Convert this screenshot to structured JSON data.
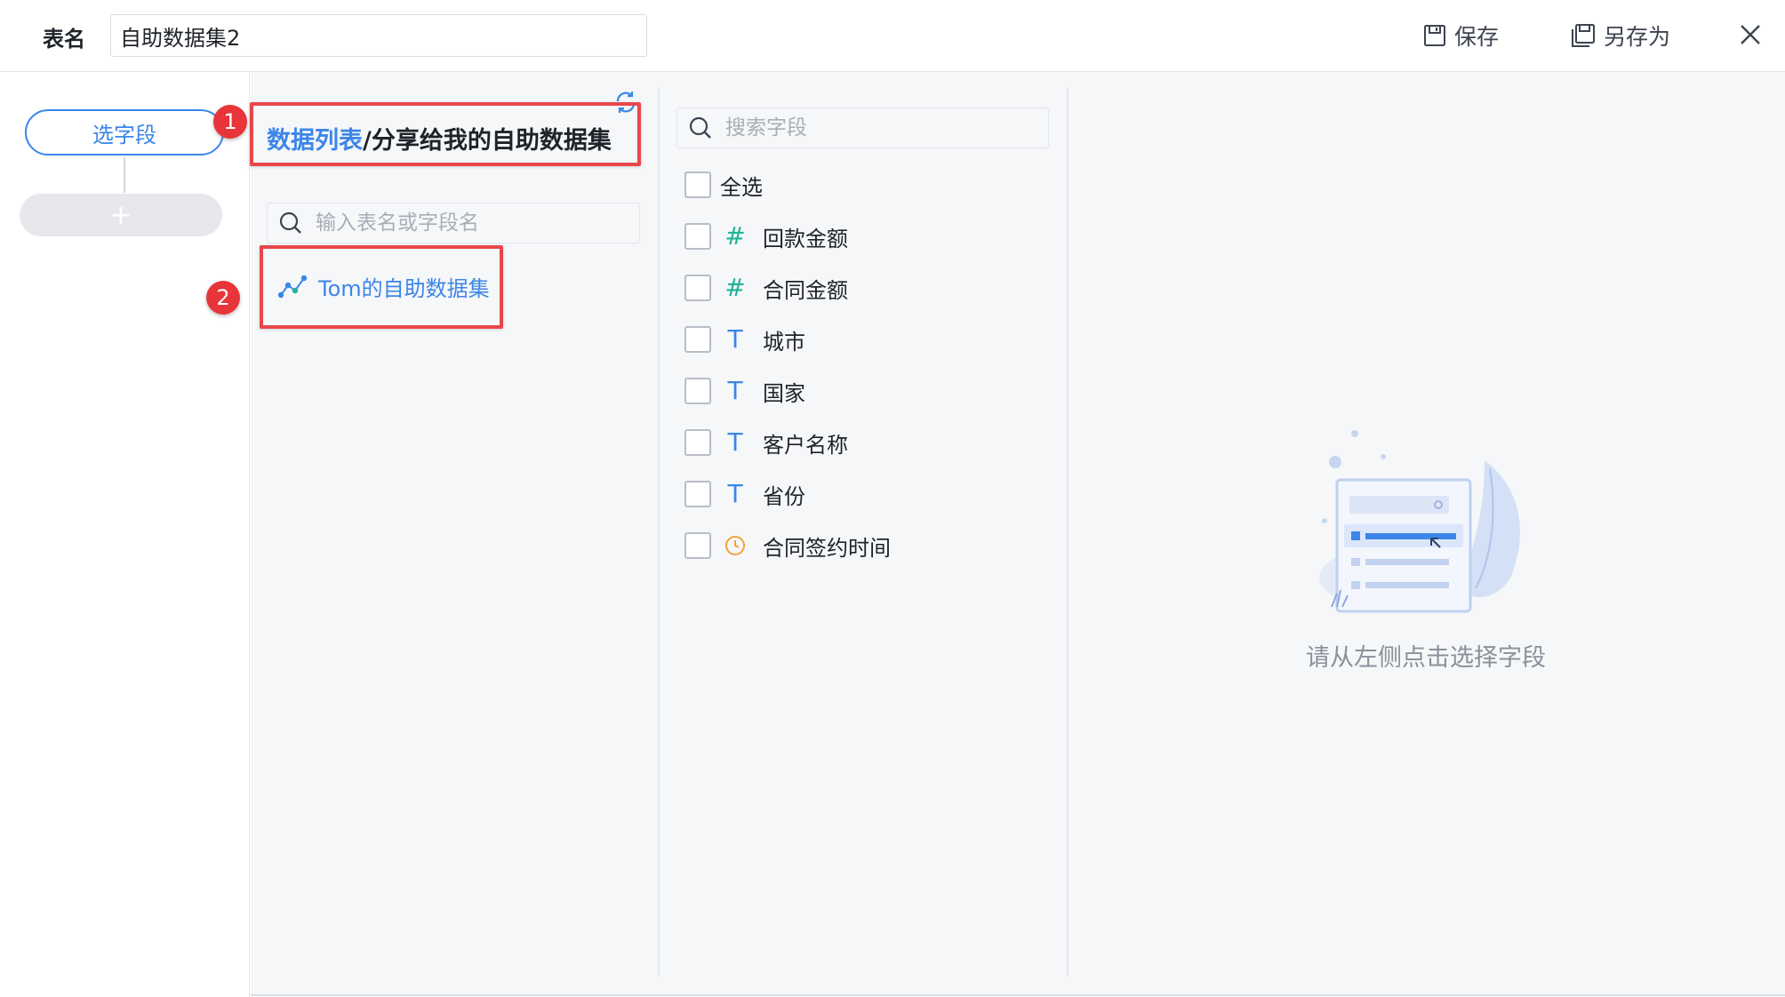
{
  "header": {
    "table_name_label": "表名",
    "table_name_value": "自助数据集2",
    "save_label": "保存",
    "save_as_label": "另存为"
  },
  "steps": {
    "current_step_label": "选字段",
    "add_step_label": "+"
  },
  "data_panel": {
    "breadcrumb_root": "数据列表",
    "breadcrumb_separator": "/",
    "breadcrumb_current": "分享给我的自助数据集",
    "search_placeholder": "输入表名或字段名",
    "items": [
      {
        "label": "Tom的自助数据集",
        "icon": "self-service-dataset-icon"
      }
    ]
  },
  "field_panel": {
    "search_placeholder": "搜索字段",
    "select_all_label": "全选",
    "fields": [
      {
        "name": "回款金额",
        "type": "number",
        "icon_glyph": "#"
      },
      {
        "name": "合同金额",
        "type": "number",
        "icon_glyph": "#"
      },
      {
        "name": "城市",
        "type": "text",
        "icon_glyph": "T"
      },
      {
        "name": "国家",
        "type": "text",
        "icon_glyph": "T"
      },
      {
        "name": "客户名称",
        "type": "text",
        "icon_glyph": "T"
      },
      {
        "name": "省份",
        "type": "text",
        "icon_glyph": "T"
      },
      {
        "name": "合同签约时间",
        "type": "date",
        "icon_glyph": "clock"
      }
    ]
  },
  "preview_panel": {
    "empty_text": "请从左侧点击选择字段"
  },
  "annotations": [
    {
      "number": "1"
    },
    {
      "number": "2"
    }
  ],
  "colors": {
    "accent": "#3c86e8",
    "number_type": "#1fb39a",
    "date_type": "#f0a23b",
    "annotation_red": "#e8353a"
  }
}
